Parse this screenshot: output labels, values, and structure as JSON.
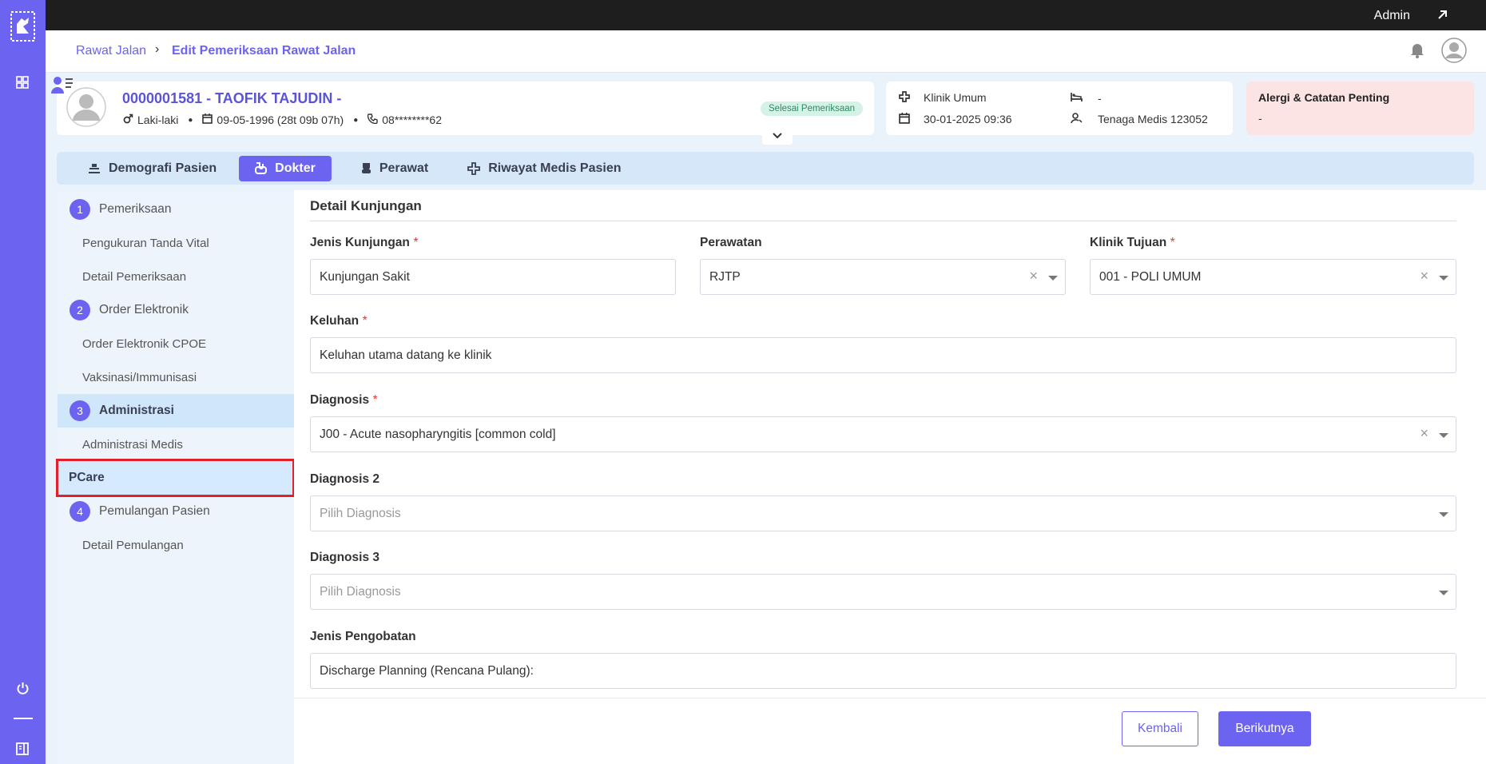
{
  "app": {
    "user_label": "Admin"
  },
  "breadcrumb": {
    "parent": "Rawat Jalan",
    "current": "Edit Pemeriksaan Rawat Jalan"
  },
  "patient": {
    "id_name": "0000001581 - TAOFIK TAJUDIN -",
    "gender": "Laki-laki",
    "dob": "09-05-1996 (28t 09b 07h)",
    "phone": "08********62",
    "status": "Selesai Pemeriksaan"
  },
  "visit": {
    "clinic": "Klinik Umum",
    "datetime": "30-01-2025 09:36",
    "room": "-",
    "medic": "Tenaga Medis 123052"
  },
  "alert": {
    "title": "Alergi & Catatan Penting",
    "value": "-"
  },
  "tabs": [
    {
      "label": "Demografi Pasien",
      "icon": "id-card-icon"
    },
    {
      "label": "Dokter",
      "icon": "stethoscope-icon",
      "active": true
    },
    {
      "label": "Perawat",
      "icon": "nurse-icon"
    },
    {
      "label": "Riwayat Medis Pasien",
      "icon": "medical-cross-icon"
    }
  ],
  "steps": {
    "s1": {
      "num": "1",
      "label": "Pemeriksaan"
    },
    "s1a": "Pengukuran Tanda Vital",
    "s1b": "Detail Pemeriksaan",
    "s2": {
      "num": "2",
      "label": "Order Elektronik"
    },
    "s2a": "Order Elektronik CPOE",
    "s2b": "Vaksinasi/Immunisasi",
    "s3": {
      "num": "3",
      "label": "Administrasi"
    },
    "s3a": "Administrasi Medis",
    "s3b": "PCare",
    "s4": {
      "num": "4",
      "label": "Pemulangan Pasien"
    },
    "s4a": "Detail Pemulangan"
  },
  "form": {
    "section_title": "Detail Kunjungan",
    "jenis_kunjungan": {
      "label": "Jenis Kunjungan",
      "required": "*",
      "value": "Kunjungan Sakit"
    },
    "perawatan": {
      "label": "Perawatan",
      "value": "RJTP"
    },
    "klinik_tujuan": {
      "label": "Klinik Tujuan",
      "required": "*",
      "value": "001 - POLI UMUM"
    },
    "keluhan": {
      "label": "Keluhan",
      "required": "*",
      "value": "Keluhan utama datang ke klinik"
    },
    "diagnosis": {
      "label": "Diagnosis",
      "required": "*",
      "value": "J00 - Acute nasopharyngitis [common cold]"
    },
    "diagnosis2": {
      "label": "Diagnosis 2",
      "placeholder": "Pilih Diagnosis"
    },
    "diagnosis3": {
      "label": "Diagnosis 3",
      "placeholder": "Pilih Diagnosis"
    },
    "jenis_pengobatan": {
      "label": "Jenis Pengobatan",
      "value": "Discharge Planning (Rencana Pulang):"
    }
  },
  "footer": {
    "back": "Kembali",
    "next": "Berikutnya"
  },
  "colors": {
    "accent": "#6c63f0",
    "highlight_border": "#e0202a",
    "alert_bg": "#fde4e4",
    "status_bg": "#d4f3e6"
  }
}
